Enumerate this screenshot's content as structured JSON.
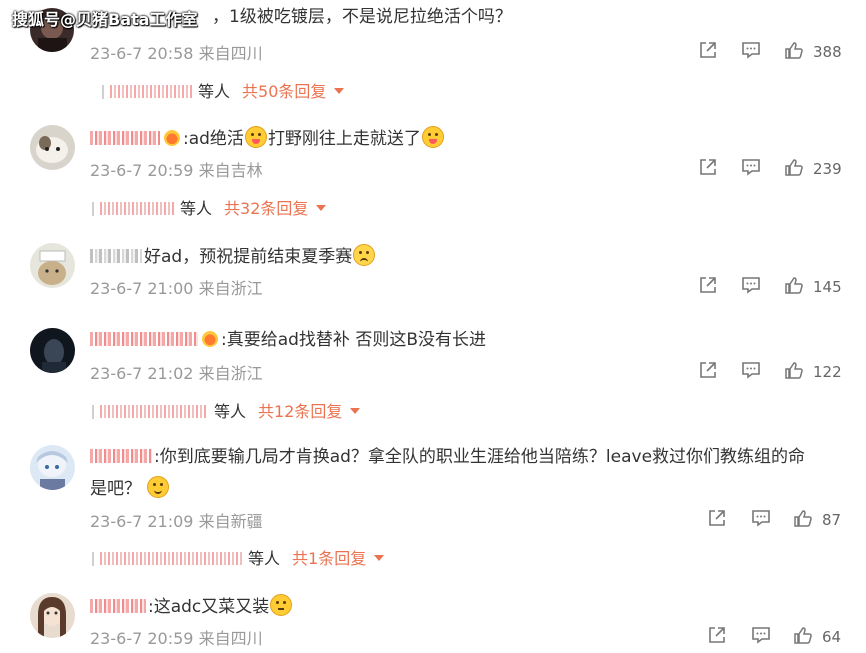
{
  "watermark": "搜狐号@贝猪Bata工作室",
  "comments": [
    {
      "text": "，1级被吃镀层，不是说尼拉绝活个吗？",
      "time": "23-6-7 20:58",
      "location": "来自四川",
      "likes": "388",
      "reply": {
        "and": "等人",
        "count_label": "共50条回复"
      }
    },
    {
      "text1": ":ad绝活",
      "text2": "打野刚往上走就送了",
      "time": "23-6-7 20:59",
      "location": "来自吉林",
      "likes": "239",
      "reply": {
        "and": "等人",
        "count_label": "共32条回复"
      }
    },
    {
      "text": "好ad，预祝提前结束夏季赛",
      "time": "23-6-7 21:00",
      "location": "来自浙江",
      "likes": "145"
    },
    {
      "text": ":真要给ad找替补 否则这B没有长进",
      "time": "23-6-7 21:02",
      "location": "来自浙江",
      "likes": "122",
      "reply": {
        "and": "等人",
        "count_label": "共12条回复"
      }
    },
    {
      "line1": ":你到底要输几局才肯换ad？拿全队的职业生涯给他当陪练？leave救过你们教练组的命",
      "line2": "是吧？",
      "time": "23-6-7 21:09",
      "location": "来自新疆",
      "likes": "87",
      "reply": {
        "and": "等人",
        "count_label": "共1条回复"
      }
    },
    {
      "text": ":这adc又菜又装",
      "time": "23-6-7 20:59",
      "location": "来自四川",
      "likes": "64"
    }
  ],
  "icons": {
    "share": "share-icon",
    "comment": "comment-icon",
    "like": "thumbs-up-icon"
  },
  "colors": {
    "link": "#eb7350",
    "meta": "#999999",
    "text": "#333333"
  }
}
